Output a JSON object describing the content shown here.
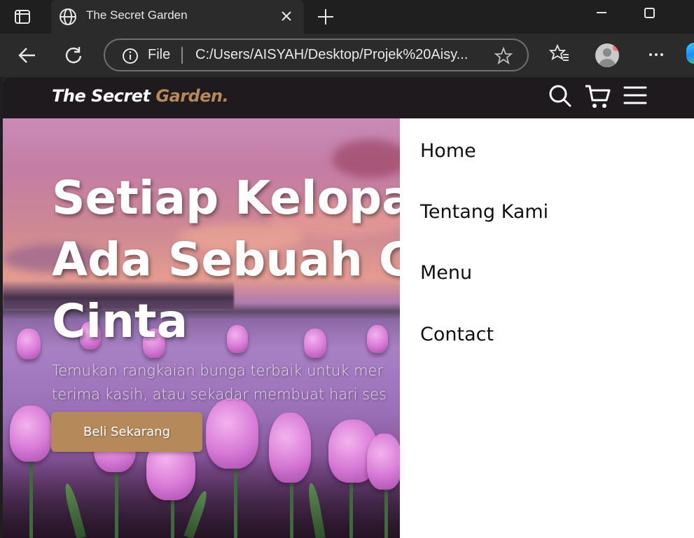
{
  "browser": {
    "tab_title": "The Secret Garden",
    "address": {
      "scheme_label": "File",
      "url": "C:/Users/AISYAH/Desktop/Projek%20Aisy..."
    },
    "icons": {
      "tab_actions": "tab-actions-icon",
      "tab_favicon": "globe-icon",
      "tab_close": "close-icon",
      "new_tab": "plus-icon",
      "minimize": "minimize-icon",
      "maximize": "maximize-icon",
      "back": "back-arrow-icon",
      "refresh": "refresh-icon",
      "site_info": "info-icon",
      "favorite": "star-icon",
      "favorites": "favorites-icon",
      "profile": "avatar",
      "more": "more-icon",
      "edge": "edge-logo-icon"
    }
  },
  "site": {
    "logo": {
      "main": "The Secret ",
      "accent": "Garden."
    },
    "nav_icons": [
      "search-icon",
      "cart-icon",
      "menu-icon"
    ],
    "hero": {
      "title_lines": [
        "Setiap Kelopak",
        "Ada Sebuah C",
        "Cinta"
      ],
      "description_lines": [
        "Temukan rangkaian bunga terbaik untuk mer",
        "terima kasih, atau sekadar membuat hari ses"
      ],
      "button_label": "Beli Sekarang"
    },
    "menu": {
      "items": [
        "Home",
        "Tentang Kami",
        "Menu",
        "Contact"
      ]
    }
  },
  "colors": {
    "chrome_dark": "#1f1f1f",
    "chrome_toolbar": "#2b2b2b",
    "site_nav_bg": "#1e1a1e",
    "accent_brown": "#b6895b",
    "menu_bg": "#ffffff",
    "menu_text": "#111111"
  }
}
